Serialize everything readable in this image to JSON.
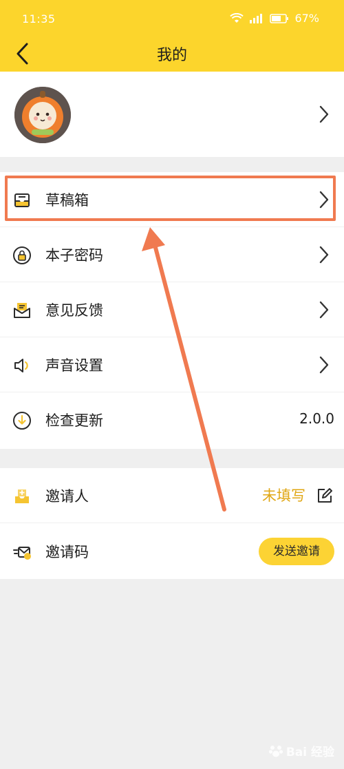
{
  "status_bar": {
    "time": "11:35",
    "battery": "67%"
  },
  "header": {
    "title": "我的"
  },
  "menu": {
    "items": [
      {
        "label": "草稿箱"
      },
      {
        "label": "本子密码"
      },
      {
        "label": "意见反馈"
      },
      {
        "label": "声音设置"
      },
      {
        "label": "检查更新",
        "value": "2.0.0"
      }
    ]
  },
  "invite": {
    "inviter_label": "邀请人",
    "inviter_status": "未填写",
    "code_label": "邀请码",
    "send_label": "发送邀请"
  },
  "watermark": {
    "text": "Bai 经验"
  },
  "colors": {
    "header": "#fcd52c",
    "accent": "#e0a715",
    "highlight": "#f07a50"
  },
  "icons": [
    "back-icon",
    "wifi-icon",
    "signal-icon",
    "battery-icon",
    "drafts-icon",
    "lock-icon",
    "feedback-icon",
    "sound-icon",
    "update-icon",
    "inviter-icon",
    "invite-code-icon",
    "edit-icon",
    "chevron-right-icon"
  ]
}
